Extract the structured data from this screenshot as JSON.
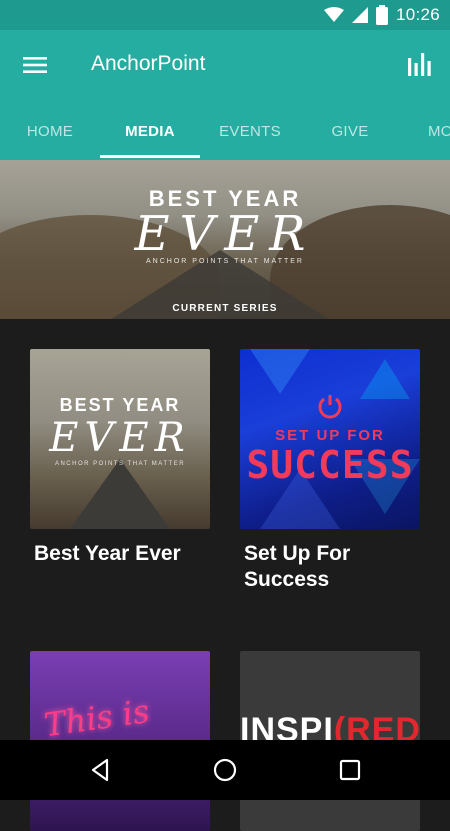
{
  "status_bar": {
    "time": "10:26",
    "icons": [
      "wifi-icon",
      "signal-icon",
      "battery-icon"
    ]
  },
  "app_bar": {
    "title": "AnchorPoint",
    "menu_icon": "hamburger-menu-icon",
    "action_icon": "bar-chart-icon"
  },
  "tabs": [
    {
      "label": "HOME",
      "active": false
    },
    {
      "label": "MEDIA",
      "active": true
    },
    {
      "label": "EVENTS",
      "active": false
    },
    {
      "label": "GIVE",
      "active": false
    },
    {
      "label": "MO",
      "active": false
    }
  ],
  "hero": {
    "line1": "BEST YEAR",
    "line2": "EVER",
    "line3": "ANCHOR POINTS THAT MATTER",
    "label": "CURRENT SERIES"
  },
  "cards": [
    {
      "title": "Best Year Ever",
      "art": {
        "line1": "BEST YEAR",
        "line2": "EVER",
        "line3": "ANCHOR POINTS THAT MATTER"
      }
    },
    {
      "title": "Set Up For Success",
      "art": {
        "line1": "SET UP FOR",
        "line2": "SUCCESS"
      }
    },
    {
      "title": "",
      "art": {
        "line1": "This is"
      }
    },
    {
      "title": "",
      "art": {
        "line1": "INSPI",
        "line2": "(RED)"
      }
    }
  ],
  "colors": {
    "status_bar": "#1f9a8e",
    "app_bar": "#26ada1",
    "background": "#1c1c1c",
    "accent_red": "#f23a5a"
  },
  "nav_bar": {
    "icons": [
      "back-icon",
      "home-icon",
      "recents-icon"
    ]
  }
}
